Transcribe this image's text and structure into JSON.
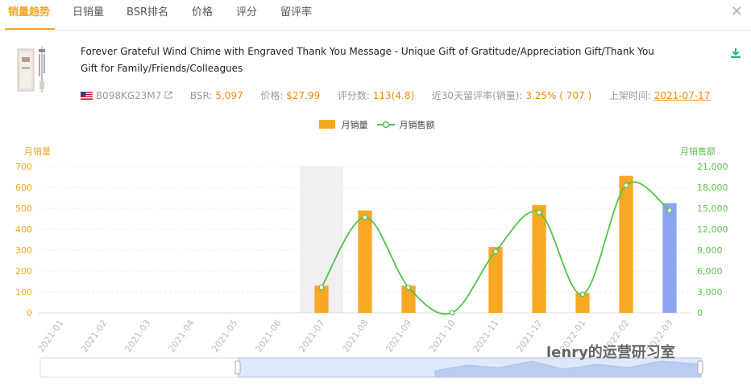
{
  "tabs": [
    "销量趋势",
    "日销量",
    "BSR排名",
    "价格",
    "评分",
    "留评率"
  ],
  "active_tab": 0,
  "close_icon": "×",
  "product": {
    "title": "Forever Grateful Wind Chime with Engraved Thank You Message - Unique Gift of Gratitude/Appreciation Gift/Thank You Gift for Family/Friends/Colleagues",
    "asin": "B098KG23M7",
    "bsr_label": "BSR:",
    "bsr": "5,097",
    "price_label": "价格:",
    "price": "$27.99",
    "ratings_label": "评分数:",
    "ratings": "113(4.8)",
    "review_rate_label": "近30天留评率(销量):",
    "review_rate": "3.25% ( 707 )",
    "listed_label": "上架时间:",
    "listed": "2021-07-17"
  },
  "legend": {
    "bar": "月销量",
    "line": "月销售额"
  },
  "watermark": "lenry的运营研习室",
  "chart_data": {
    "type": "bar+line",
    "categories": [
      "2021-01",
      "2021-02",
      "2021-03",
      "2021-04",
      "2021-05",
      "2021-06",
      "2021-07",
      "2021-08",
      "2021-09",
      "2021-10",
      "2021-11",
      "2021-12",
      "2022-01",
      "2022-02",
      "2022-03"
    ],
    "series": [
      {
        "name": "月销量",
        "type": "bar",
        "axis": "left",
        "color": "#f9a825",
        "values": [
          null,
          null,
          null,
          null,
          null,
          null,
          130,
          490,
          130,
          0,
          315,
          515,
          95,
          655,
          525
        ],
        "highlight_color": "#8ea4f2",
        "highlight_index": 14
      },
      {
        "name": "月销售额",
        "type": "line",
        "axis": "right",
        "color": "#4fc34a",
        "values": [
          null,
          null,
          null,
          null,
          null,
          null,
          3650,
          13700,
          3650,
          0,
          8800,
          14400,
          2650,
          18300,
          14700
        ]
      }
    ],
    "ylabel": "月销量",
    "ylabel_right": "月销售额",
    "yticks_left": [
      "0",
      "100",
      "200",
      "300",
      "400",
      "500",
      "600",
      "700"
    ],
    "yticks_right": [
      "0",
      "3,000",
      "6,000",
      "9,000",
      "12,000",
      "15,000",
      "18,000",
      "21,000"
    ],
    "ylim": [
      0,
      700
    ],
    "ylim_right": [
      0,
      21000
    ],
    "shaded_category": "2021-07",
    "grid": true
  },
  "colors": {
    "accent": "#f5a623",
    "bar": "#f9a825",
    "line": "#4fc34a",
    "highlight": "#8ea4f2"
  }
}
